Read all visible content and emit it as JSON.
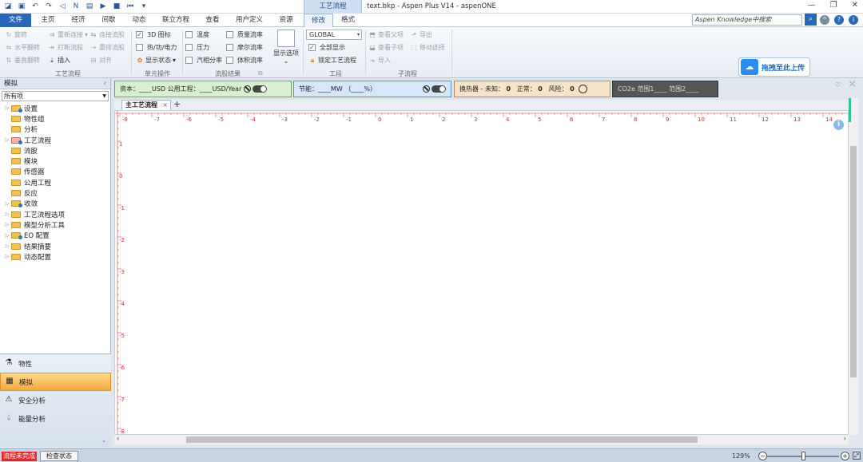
{
  "window": {
    "title": "text.bkp - Aspen Plus V14 - aspenONE",
    "context_tab": "工艺流程"
  },
  "tabs": [
    "文件",
    "主页",
    "经济",
    "间歇",
    "动态",
    "联立方程",
    "查看",
    "用户定义",
    "资源",
    "修改",
    "格式"
  ],
  "search": {
    "placeholder": "Aspen Knowledge中搜索"
  },
  "ribbon": {
    "flowsheet_group": {
      "label": "工艺流程",
      "items": [
        "旋转",
        "水平翻转",
        "垂直翻转",
        "重新连接",
        "打断流股",
        "插入",
        "连接流股",
        "重排流股",
        "对齐"
      ]
    },
    "unit_ops_group": {
      "label": "单元操作",
      "items": [
        "3D 图标",
        "热/功/电力",
        "显示状态"
      ]
    },
    "stream_results_group": {
      "label": "流股结果",
      "items": [
        "温度",
        "压力",
        "汽相分率",
        "质量流率",
        "摩尔流率",
        "体积流率"
      ]
    },
    "display_options": "显示选项",
    "section_group": {
      "label": "工段",
      "select_value": "GLOBAL",
      "items": [
        "全部显示",
        "锁定工艺流程"
      ]
    },
    "sub_flowsheet_group": {
      "label": "子流程",
      "items": [
        "查看父项",
        "导出",
        "查看子项",
        "移动选择",
        "导入"
      ]
    },
    "upload_label": "拖拽至此上传"
  },
  "nav": {
    "header": "模拟",
    "filter": "所有项",
    "tree": [
      "设置",
      "物性组",
      "分析",
      "工艺流程",
      "流股",
      "模块",
      "传感器",
      "公用工程",
      "反应",
      "收敛",
      "工艺流程选项",
      "模型分析工具",
      "EO 配置",
      "结果摘要",
      "动态配置"
    ],
    "buttons": [
      "物性",
      "模拟",
      "安全分析",
      "能量分析"
    ]
  },
  "kpi": {
    "cost": "资本：____USD  公用工程：____USD/Year",
    "energy": "节能：____MW  （____%）",
    "heat_exchanger_label": "换热器 - 未知：",
    "he_unknown": "0",
    "he_normal_label": "正常：",
    "he_normal": "0",
    "he_risk_label": "风险：",
    "he_risk": "0",
    "co2": "CO2e 范围1____  范围2____",
    "colors": {
      "cost": "#d8f0d0",
      "energy": "#d7e7fb",
      "heat": "#f6e3c8",
      "co2": "#555555"
    }
  },
  "flowsheet": {
    "tab_label": "主工艺流程",
    "x_ticks": [
      "-8",
      "-7",
      "-6",
      "-5",
      "-4",
      "-3",
      "-2",
      "-1",
      "0",
      "1",
      "2",
      "3",
      "4",
      "5",
      "6",
      "7",
      "8",
      "9",
      "10",
      "11",
      "12",
      "13",
      "14"
    ],
    "y_ticks": [
      "1",
      "0",
      "-1",
      "-2",
      "-3",
      "-4",
      "-5",
      "-6",
      "-7",
      "-8"
    ]
  },
  "status": {
    "state": "流程未完成",
    "check_button": "检查状态",
    "zoom": "129%"
  }
}
